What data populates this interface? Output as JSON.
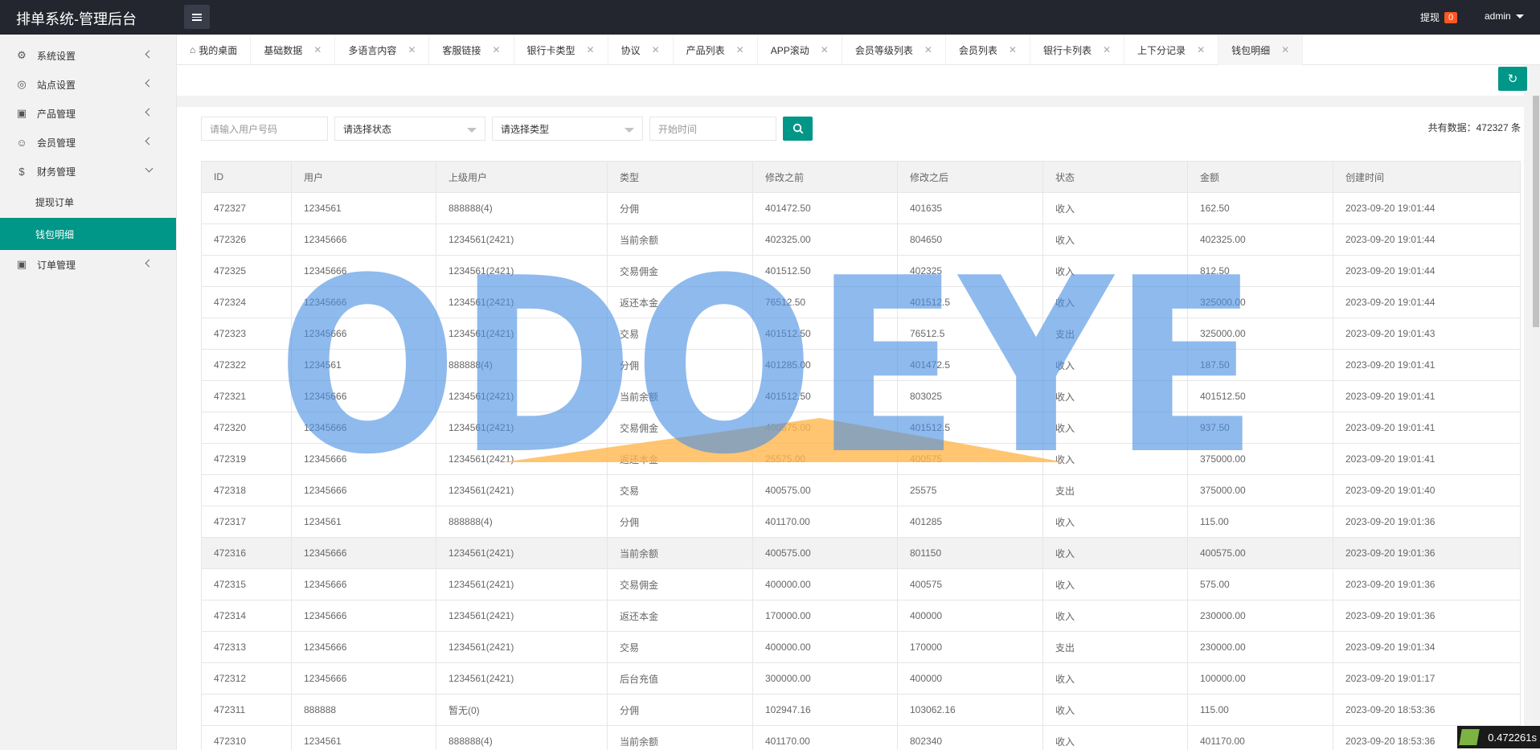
{
  "app": {
    "title": "排单系统-管理后台"
  },
  "header": {
    "withdraw_label": "提现",
    "withdraw_count": "0",
    "user": "admin"
  },
  "sidebar": {
    "items": [
      {
        "label": "系统设置",
        "icon": "gear-icon"
      },
      {
        "label": "站点设置",
        "icon": "globe-icon"
      },
      {
        "label": "产品管理",
        "icon": "box-icon"
      },
      {
        "label": "会员管理",
        "icon": "user-icon"
      },
      {
        "label": "财务管理",
        "icon": "dollar-icon"
      }
    ],
    "sub_items": [
      {
        "label": "提现订单"
      },
      {
        "label": "钱包明细"
      }
    ],
    "order_item": {
      "label": "订单管理",
      "icon": "box-icon"
    }
  },
  "tabs": [
    {
      "label": "我的桌面"
    },
    {
      "label": "基础数据"
    },
    {
      "label": "多语言内容"
    },
    {
      "label": "客服链接"
    },
    {
      "label": "银行卡类型"
    },
    {
      "label": "协议"
    },
    {
      "label": "产品列表"
    },
    {
      "label": "APP滚动"
    },
    {
      "label": "会员等级列表"
    },
    {
      "label": "会员列表"
    },
    {
      "label": "银行卡列表"
    },
    {
      "label": "上下分记录"
    },
    {
      "label": "钱包明细"
    }
  ],
  "search": {
    "user_placeholder": "请输入用户号码",
    "status_select": "请选择状态",
    "type_select": "请选择类型",
    "start_time_placeholder": "开始时间"
  },
  "total": {
    "label": "共有数据：472327 条"
  },
  "table": {
    "headers": [
      "ID",
      "用户",
      "上级用户",
      "类型",
      "修改之前",
      "修改之后",
      "状态",
      "金额",
      "创建时间"
    ],
    "rows": [
      [
        "472327",
        "1234561",
        "888888(4)",
        "分佣",
        "401472.50",
        "401635",
        "收入",
        "162.50",
        "2023-09-20 19:01:44"
      ],
      [
        "472326",
        "12345666",
        "1234561(2421)",
        "当前余额",
        "402325.00",
        "804650",
        "收入",
        "402325.00",
        "2023-09-20 19:01:44"
      ],
      [
        "472325",
        "12345666",
        "1234561(2421)",
        "交易佣金",
        "401512.50",
        "402325",
        "收入",
        "812.50",
        "2023-09-20 19:01:44"
      ],
      [
        "472324",
        "12345666",
        "1234561(2421)",
        "返还本金",
        "76512.50",
        "401512.5",
        "收入",
        "325000.00",
        "2023-09-20 19:01:44"
      ],
      [
        "472323",
        "12345666",
        "1234561(2421)",
        "交易",
        "401512.50",
        "76512.5",
        "支出",
        "325000.00",
        "2023-09-20 19:01:43"
      ],
      [
        "472322",
        "1234561",
        "888888(4)",
        "分佣",
        "401285.00",
        "401472.5",
        "收入",
        "187.50",
        "2023-09-20 19:01:41"
      ],
      [
        "472321",
        "12345666",
        "1234561(2421)",
        "当前余额",
        "401512.50",
        "803025",
        "收入",
        "401512.50",
        "2023-09-20 19:01:41"
      ],
      [
        "472320",
        "12345666",
        "1234561(2421)",
        "交易佣金",
        "400575.00",
        "401512.5",
        "收入",
        "937.50",
        "2023-09-20 19:01:41"
      ],
      [
        "472319",
        "12345666",
        "1234561(2421)",
        "返还本金",
        "25575.00",
        "400575",
        "收入",
        "375000.00",
        "2023-09-20 19:01:41"
      ],
      [
        "472318",
        "12345666",
        "1234561(2421)",
        "交易",
        "400575.00",
        "25575",
        "支出",
        "375000.00",
        "2023-09-20 19:01:40"
      ],
      [
        "472317",
        "1234561",
        "888888(4)",
        "分佣",
        "401170.00",
        "401285",
        "收入",
        "115.00",
        "2023-09-20 19:01:36"
      ],
      [
        "472316",
        "12345666",
        "1234561(2421)",
        "当前余额",
        "400575.00",
        "801150",
        "收入",
        "400575.00",
        "2023-09-20 19:01:36"
      ],
      [
        "472315",
        "12345666",
        "1234561(2421)",
        "交易佣金",
        "400000.00",
        "400575",
        "收入",
        "575.00",
        "2023-09-20 19:01:36"
      ],
      [
        "472314",
        "12345666",
        "1234561(2421)",
        "返还本金",
        "170000.00",
        "400000",
        "收入",
        "230000.00",
        "2023-09-20 19:01:36"
      ],
      [
        "472313",
        "12345666",
        "1234561(2421)",
        "交易",
        "400000.00",
        "170000",
        "支出",
        "230000.00",
        "2023-09-20 19:01:34"
      ],
      [
        "472312",
        "12345666",
        "1234561(2421)",
        "后台充值",
        "300000.00",
        "400000",
        "收入",
        "100000.00",
        "2023-09-20 19:01:17"
      ],
      [
        "472311",
        "888888",
        "暂无(0)",
        "分佣",
        "102947.16",
        "103062.16",
        "收入",
        "115.00",
        "2023-09-20 18:53:36"
      ],
      [
        "472310",
        "1234561",
        "888888(4)",
        "当前余额",
        "401170.00",
        "802340",
        "收入",
        "401170.00",
        "2023-09-20 18:53:36"
      ]
    ],
    "highlight_row": 11
  },
  "watermark": {
    "text": "ODOEYE"
  },
  "timer": {
    "value": "0.472261s"
  },
  "colors": {
    "primary": "#009688",
    "header_bg": "#23262e",
    "badge": "#ff5722"
  }
}
